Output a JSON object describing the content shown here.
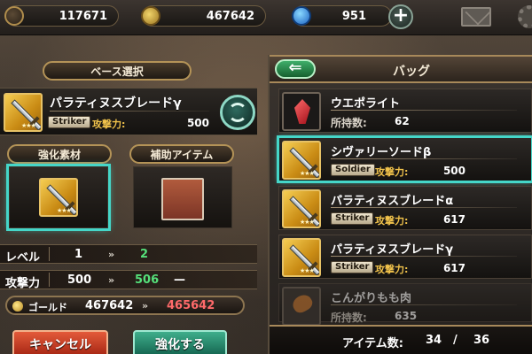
{
  "topbar": {
    "resource1": "117671",
    "gold": "467642",
    "gems": "951",
    "plus_label": "+"
  },
  "left": {
    "base_title": "ベース選択",
    "base_item": {
      "name": "パラティヌスブレードγ",
      "tag": "Striker",
      "atk_label": "攻撃力:",
      "atk_value": "500"
    },
    "material_title": "強化素材",
    "support_title": "補助アイテム",
    "level_row": {
      "label": "レベル",
      "from": "1",
      "arrows": "»",
      "to": "2"
    },
    "attack_row": {
      "label": "攻撃力",
      "from": "500",
      "arrows": "»",
      "to": "506",
      "dash": "—"
    },
    "gold_row": {
      "label": "ゴールド",
      "from": "467642",
      "arrows": "»",
      "to": "465642"
    },
    "cancel_label": "キャンセル",
    "enhance_label": "強化する"
  },
  "bag": {
    "title": "バッグ",
    "back_label": "⇐",
    "items": [
      {
        "name": "ウエポライト",
        "sub_label": "所持数:",
        "sub_value": "62"
      },
      {
        "name": "シヴァリーソードβ",
        "tag": "Soldier",
        "atk_label": "攻撃力:",
        "atk_value": "500"
      },
      {
        "name": "パラティヌスブレードα",
        "tag": "Striker",
        "atk_label": "攻撃力:",
        "atk_value": "617"
      },
      {
        "name": "パラティヌスブレードγ",
        "tag": "Striker",
        "atk_label": "攻撃力:",
        "atk_value": "617"
      },
      {
        "name": "こんがりもも肉",
        "sub_label": "所持数:",
        "sub_value": "635"
      }
    ],
    "footer": {
      "label": "アイテム数:",
      "count": "34",
      "slash": "/",
      "max": "36"
    }
  },
  "colors": {
    "accent_teal": "#45d6c8",
    "gold_text": "#f0c24b",
    "increase_green": "#55e07a",
    "decrease_red": "#ff6a6a"
  }
}
